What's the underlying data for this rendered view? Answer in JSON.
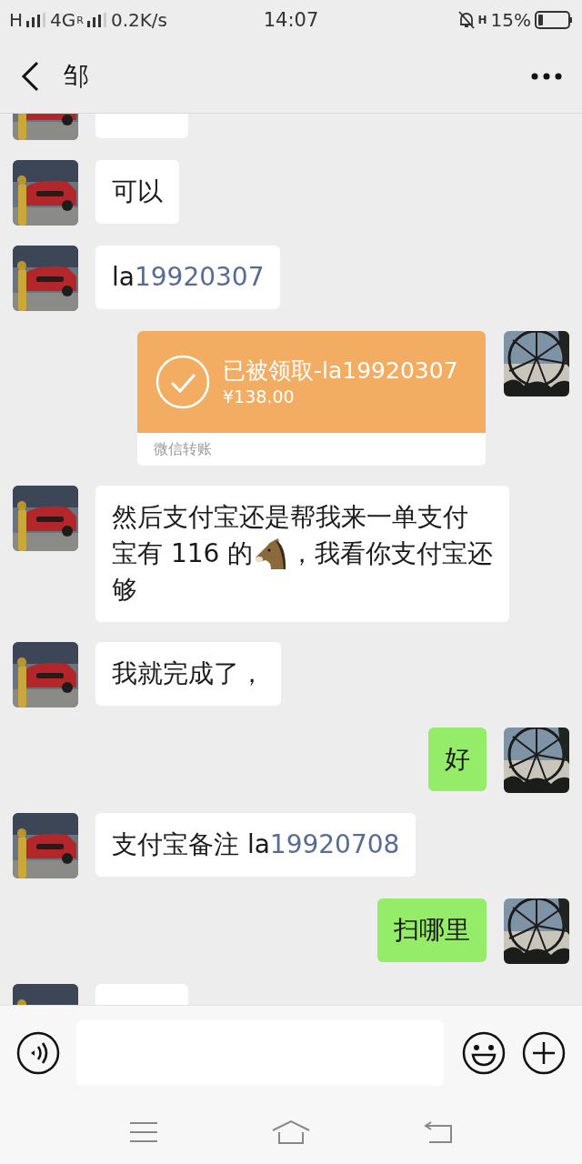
{
  "status_bar": {
    "network_1": "H",
    "network_2": "4G",
    "roaming": "R",
    "speed": "0.2K/s",
    "time": "14:07",
    "data_type": "H",
    "battery": "15%"
  },
  "header": {
    "title": "邹"
  },
  "messages": [
    {
      "sent": false,
      "kind": "cut"
    },
    {
      "sent": false,
      "kind": "text",
      "parts": [
        {
          "kind": "text",
          "text": "可以"
        }
      ]
    },
    {
      "sent": false,
      "kind": "text",
      "parts": [
        {
          "kind": "text",
          "text": "la"
        },
        {
          "kind": "link",
          "text": "19920307"
        }
      ]
    },
    {
      "sent": true,
      "kind": "transfer",
      "title": "已被领取-la19920307",
      "amount": "¥138.00",
      "label": "微信转账"
    },
    {
      "sent": false,
      "kind": "text",
      "parts": [
        {
          "kind": "text",
          "text": "然后支付宝还是帮我来一单支付"
        },
        {
          "kind": "break"
        },
        {
          "kind": "text",
          "text": "宝有 116 的"
        },
        {
          "kind": "emoji"
        },
        {
          "kind": "text",
          "text": "，我看你支付宝还"
        },
        {
          "kind": "break"
        },
        {
          "kind": "text",
          "text": "够"
        }
      ]
    },
    {
      "sent": false,
      "kind": "text",
      "parts": [
        {
          "kind": "text",
          "text": "我就完成了，"
        }
      ]
    },
    {
      "sent": true,
      "kind": "text",
      "parts": [
        {
          "kind": "text",
          "text": "好"
        }
      ]
    },
    {
      "sent": false,
      "kind": "text",
      "parts": [
        {
          "kind": "text",
          "text": "支付宝备注 la"
        },
        {
          "kind": "link",
          "text": "19920708"
        }
      ]
    },
    {
      "sent": true,
      "kind": "text",
      "parts": [
        {
          "kind": "text",
          "text": "扫哪里"
        }
      ]
    },
    {
      "sent": false,
      "kind": "cut"
    }
  ]
}
